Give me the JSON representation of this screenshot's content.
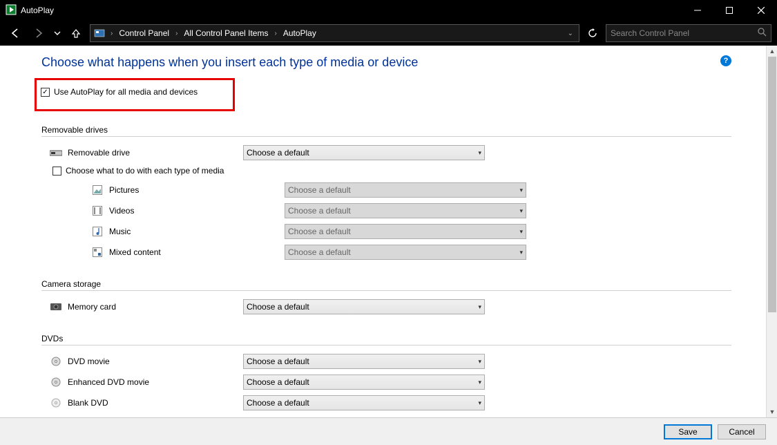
{
  "window": {
    "title": "AutoPlay"
  },
  "breadcrumb": {
    "items": [
      "Control Panel",
      "All Control Panel Items",
      "AutoPlay"
    ]
  },
  "search": {
    "placeholder": "Search Control Panel"
  },
  "heading": "Choose what happens when you insert each type of media or device",
  "use_autoplay": {
    "label": "Use AutoPlay for all media and devices",
    "checked": true
  },
  "sections": {
    "removable": {
      "title": "Removable drives",
      "item_label": "Removable drive",
      "combo_text": "Choose a default",
      "sub_checkbox": {
        "label": "Choose what to do with each type of media",
        "checked": false
      },
      "media_types": [
        {
          "label": "Pictures",
          "combo": "Choose a default"
        },
        {
          "label": "Videos",
          "combo": "Choose a default"
        },
        {
          "label": "Music",
          "combo": "Choose a default"
        },
        {
          "label": "Mixed content",
          "combo": "Choose a default"
        }
      ]
    },
    "camera": {
      "title": "Camera storage",
      "item_label": "Memory card",
      "combo_text": "Choose a default"
    },
    "dvds": {
      "title": "DVDs",
      "items": [
        {
          "label": "DVD movie",
          "combo": "Choose a default"
        },
        {
          "label": "Enhanced DVD movie",
          "combo": "Choose a default"
        },
        {
          "label": "Blank DVD",
          "combo": "Choose a default"
        }
      ]
    }
  },
  "footer": {
    "save": "Save",
    "cancel": "Cancel"
  }
}
